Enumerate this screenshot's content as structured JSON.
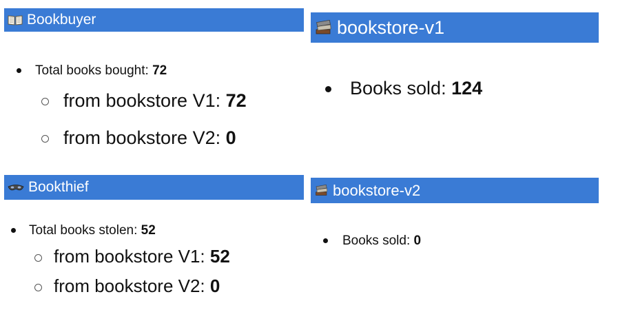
{
  "bookbuyer": {
    "title": "Bookbuyer",
    "icon": "open-book-icon",
    "total_label": "Total books bought: ",
    "total_value": "72",
    "v1_label": "from bookstore V1: ",
    "v1_value": "72",
    "v2_label": "from bookstore V2: ",
    "v2_value": "0"
  },
  "bookstore_v1": {
    "title": "bookstore-v1",
    "icon": "stacked-books-icon",
    "sold_label": "Books sold: ",
    "sold_value": "124"
  },
  "bookthief": {
    "title": "Bookthief",
    "icon": "thief-mask-icon",
    "total_label": "Total books stolen: ",
    "total_value": "52",
    "v1_label": "from bookstore V1: ",
    "v1_value": "52",
    "v2_label": "from bookstore V2: ",
    "v2_value": "0"
  },
  "bookstore_v2": {
    "title": "bookstore-v2",
    "icon": "stacked-books-icon",
    "sold_label": "Books sold: ",
    "sold_value": "0"
  },
  "colors": {
    "header_bg": "#3a7bd5",
    "header_text": "#ffffff"
  }
}
